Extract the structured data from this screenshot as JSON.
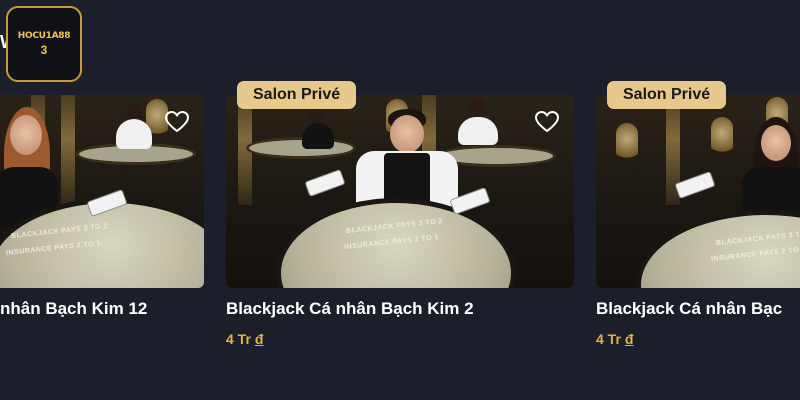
{
  "brand": {
    "logo_text": "HOCU1A88",
    "logo_sub": "3"
  },
  "edge_mark": "W",
  "cards": [
    {
      "title": "nhân Bạch Kim 12",
      "price": "",
      "currency": "",
      "badge": "",
      "favorite_icon": "heart-outline-icon"
    },
    {
      "title": "Blackjack Cá nhân Bạch Kim 2",
      "price": "4 Tr",
      "currency": "đ",
      "badge": "Salon Privé",
      "favorite_icon": "heart-outline-icon"
    },
    {
      "title": "Blackjack Cá nhân Bạc",
      "price": "4 Tr",
      "currency": "đ",
      "badge": "Salon Privé",
      "favorite_icon": ""
    }
  ],
  "table_print": [
    "BLACKJACK PAYS 3 TO 2",
    "INSURANCE PAYS 2 TO 1"
  ],
  "colors": {
    "background": "#1c1f2b",
    "badge": "#e7c98c",
    "price": "#e8b339",
    "logo_border": "#c89a3a"
  }
}
